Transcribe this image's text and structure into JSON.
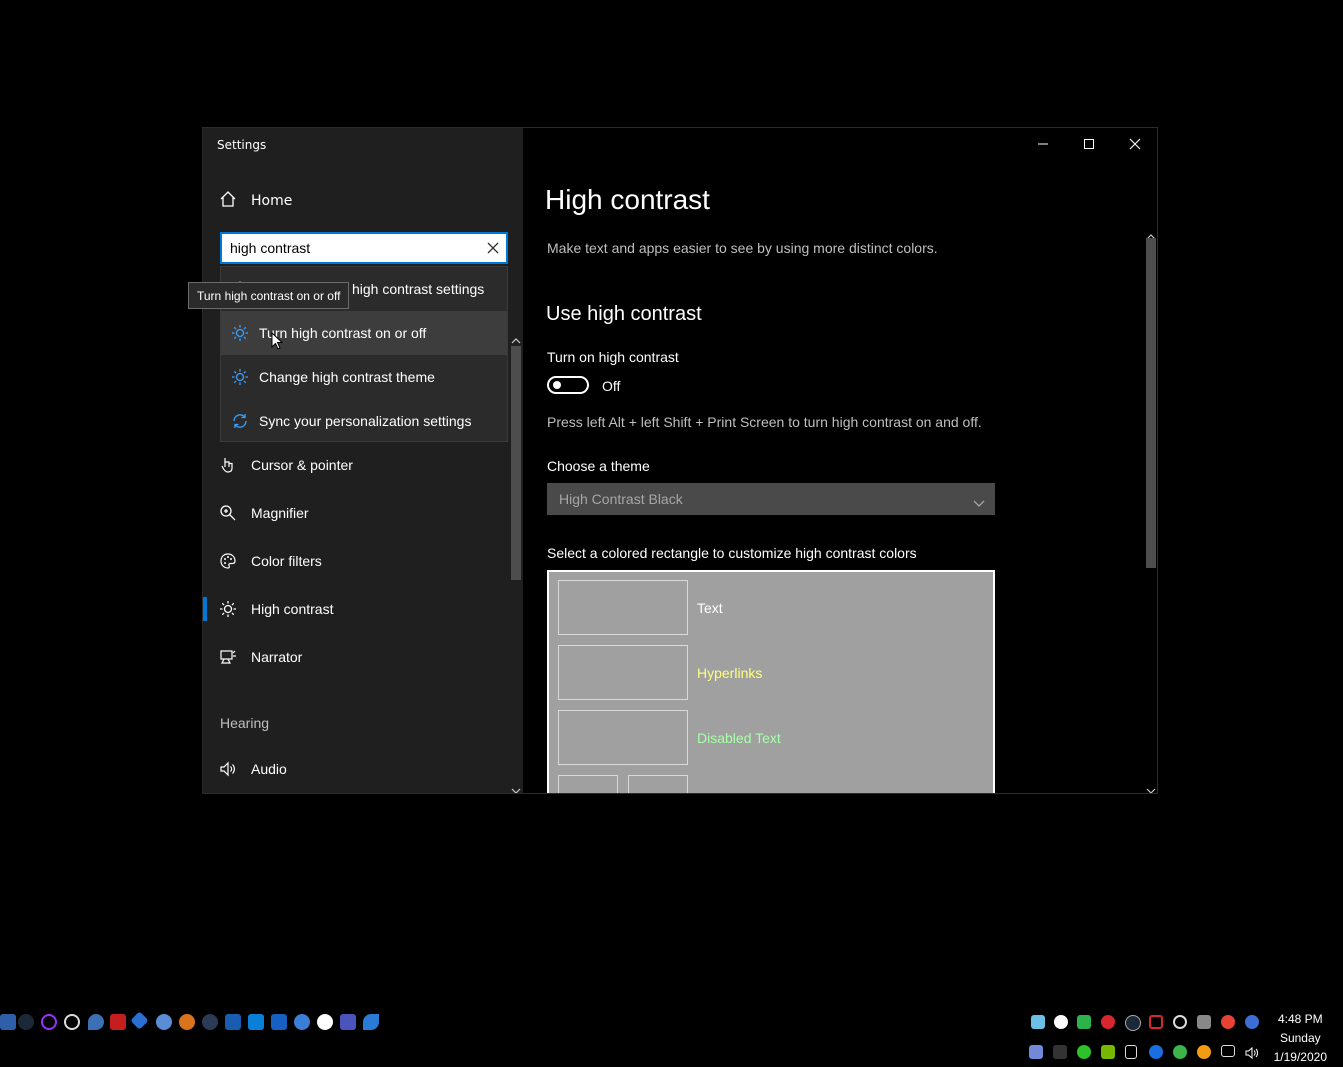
{
  "window": {
    "title": "Settings",
    "controls": {
      "minimize": "minimize",
      "maximize": "maximize",
      "close": "close"
    }
  },
  "sidebar": {
    "home_label": "Home",
    "search": {
      "value": "high contrast",
      "placeholder": ""
    },
    "suggestions": [
      {
        "label": "high contrast settings",
        "icon": "sun-icon"
      },
      {
        "label": "Turn high contrast on or off",
        "icon": "sun-icon"
      },
      {
        "label": "Change high contrast theme",
        "icon": "sun-icon"
      },
      {
        "label": "Sync your personalization settings",
        "icon": "sync-icon"
      }
    ],
    "tooltip": "Turn high contrast on or off",
    "items": [
      {
        "label": "Cursor & pointer",
        "icon": "cursor-icon"
      },
      {
        "label": "Magnifier",
        "icon": "magnifier-icon"
      },
      {
        "label": "Color filters",
        "icon": "palette-icon"
      },
      {
        "label": "High contrast",
        "icon": "sun-icon",
        "active": true
      },
      {
        "label": "Narrator",
        "icon": "narrator-icon"
      }
    ],
    "section_hearing": "Hearing",
    "audio_label": "Audio"
  },
  "main": {
    "title": "High contrast",
    "description": "Make text and apps easier to see by using more distinct colors.",
    "section_title": "Use high contrast",
    "toggle_label": "Turn on high contrast",
    "toggle_state": "Off",
    "hint": "Press left Alt + left Shift + Print Screen to turn high contrast on and off.",
    "theme_label": "Choose a theme",
    "theme_value": "High Contrast Black",
    "palette_label": "Select a colored rectangle to customize high contrast colors",
    "palette": [
      {
        "label": "Text",
        "color": "#ffffff"
      },
      {
        "label": "Hyperlinks",
        "color": "#ffff80"
      },
      {
        "label": "Disabled Text",
        "color": "#a8ffa8"
      }
    ]
  },
  "taskbar": {
    "clock": {
      "time": "4:48 PM",
      "day": "Sunday",
      "date": "1/19/2020"
    }
  },
  "colors": {
    "accent": "#0078d7",
    "sidebar_bg": "#1f1f1f",
    "palette_bg": "#a0a0a0"
  }
}
